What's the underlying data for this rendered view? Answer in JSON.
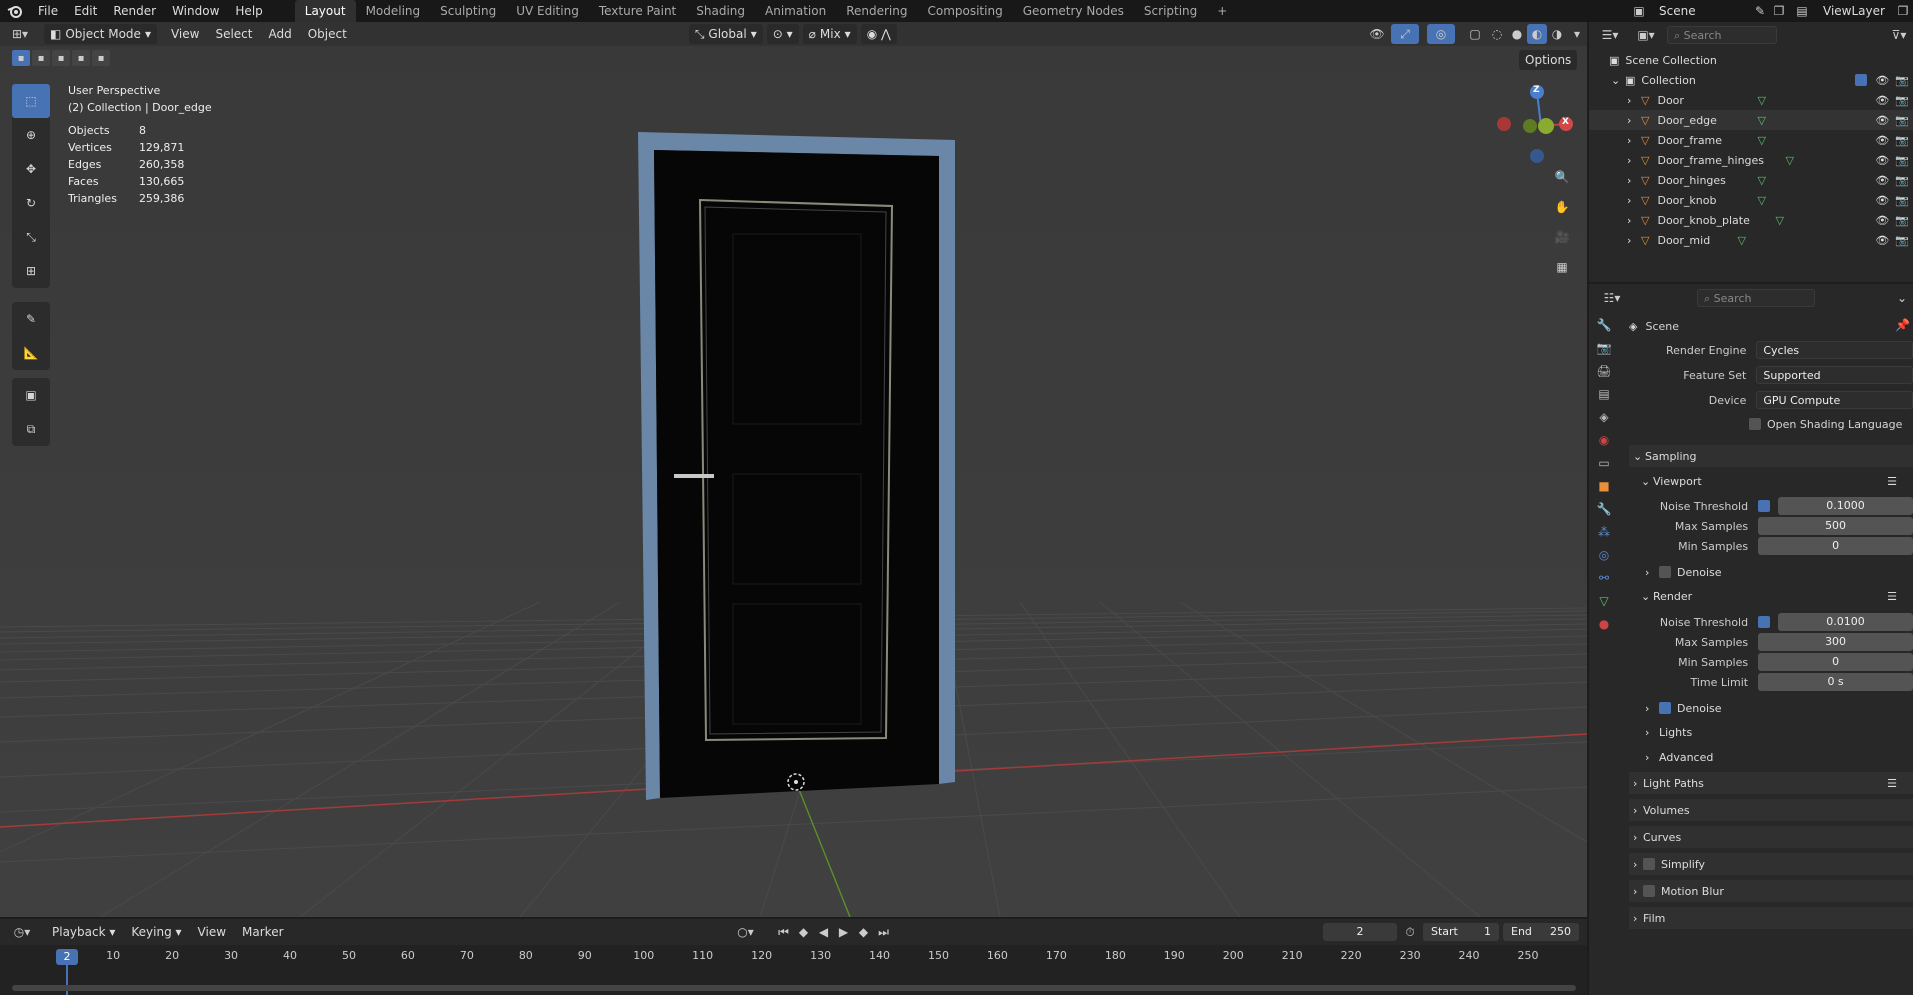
{
  "topbar": {
    "menus": [
      "File",
      "Edit",
      "Render",
      "Window",
      "Help"
    ],
    "workspaces": [
      "Layout",
      "Modeling",
      "Sculpting",
      "UV Editing",
      "Texture Paint",
      "Shading",
      "Animation",
      "Rendering",
      "Compositing",
      "Geometry Nodes",
      "Scripting"
    ],
    "active_workspace": "Layout",
    "scene": "Scene",
    "view_layer": "ViewLayer"
  },
  "viewport": {
    "mode": "Object Mode",
    "menus": [
      "View",
      "Select",
      "Add",
      "Object"
    ],
    "orientation": "Global",
    "snap": "Mix",
    "options": "Options",
    "title": "User Perspective",
    "subtitle": "(2) Collection | Door_edge",
    "stats": [
      {
        "label": "Objects",
        "value": "8"
      },
      {
        "label": "Vertices",
        "value": "129,871"
      },
      {
        "label": "Edges",
        "value": "260,358"
      },
      {
        "label": "Faces",
        "value": "130,665"
      },
      {
        "label": "Triangles",
        "value": "259,386"
      }
    ],
    "gizmo": {
      "z": "Z",
      "x": "X"
    }
  },
  "outliner": {
    "search_placeholder": "Search",
    "scene_collection": "Scene Collection",
    "collection": "Collection",
    "items": [
      "Door",
      "Door_edge",
      "Door_frame",
      "Door_frame_hinges",
      "Door_hinges",
      "Door_knob",
      "Door_knob_plate",
      "Door_mid"
    ]
  },
  "properties": {
    "search_placeholder": "Search",
    "context": "Scene",
    "render_engine_label": "Render Engine",
    "render_engine": "Cycles",
    "feature_set_label": "Feature Set",
    "feature_set": "Supported",
    "device_label": "Device",
    "device": "GPU Compute",
    "osl_label": "Open Shading Language",
    "sampling": "Sampling",
    "viewport": "Viewport",
    "noise_threshold_label": "Noise Threshold",
    "vp_noise_threshold": "0.1000",
    "max_samples_label": "Max Samples",
    "vp_max_samples": "500",
    "min_samples_label": "Min Samples",
    "vp_min_samples": "0",
    "denoise": "Denoise",
    "render": "Render",
    "r_noise_threshold": "0.0100",
    "r_max_samples": "300",
    "r_min_samples": "0",
    "time_limit_label": "Time Limit",
    "r_time_limit": "0 s",
    "lights": "Lights",
    "advanced": "Advanced",
    "light_paths": "Light Paths",
    "volumes": "Volumes",
    "curves": "Curves",
    "simplify": "Simplify",
    "motion_blur": "Motion Blur",
    "film": "Film"
  },
  "timeline": {
    "menus": [
      "Playback",
      "Keying",
      "View",
      "Marker"
    ],
    "current_frame": "2",
    "start_label": "Start",
    "start": "1",
    "end_label": "End",
    "end": "250",
    "ticks": [
      "10",
      "20",
      "30",
      "40",
      "50",
      "60",
      "70",
      "80",
      "90",
      "100",
      "110",
      "120",
      "130",
      "140",
      "150",
      "160",
      "170",
      "180",
      "190",
      "200",
      "210",
      "220",
      "230",
      "240",
      "250"
    ]
  },
  "colors": {
    "accent": "#4772b3",
    "frame": "#6a87a8",
    "red_axis": "#c24040",
    "green_axis": "#6c9c2c"
  }
}
